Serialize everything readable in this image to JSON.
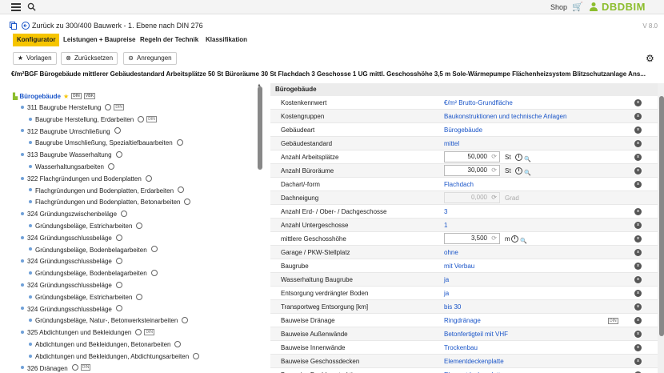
{
  "topbar": {
    "shop_label": "Shop",
    "logo": "DBDBIM",
    "menu_icon": "menu-icon",
    "search_icon": "search-icon",
    "cart_icon": "cart-icon",
    "user_icon": "user-icon"
  },
  "nav": {
    "back_label": "Zurück zu 300/400 Bauwerk - 1. Ebene nach DIN 276",
    "version": "V 8.0"
  },
  "tabs": [
    {
      "label": "Konfigurator",
      "active": true
    },
    {
      "label": "Leistungen + Baupreise",
      "active": false
    },
    {
      "label": "Regeln der Technik",
      "active": false
    },
    {
      "label": "Klassifikation",
      "active": false
    }
  ],
  "actions": {
    "vorlagen": "Vorlagen",
    "zuruecksetzen": "Zurücksetzen",
    "anregungen": "Anregungen"
  },
  "summary": "€/m²BGF Bürogebäude mittlerer Gebäudestandard Arbeitsplätze 50 St Büroräume 30 St Flachdach 3 Geschosse 1 UG mittl. Geschosshöhe 3,5 m Sole-Wärmepumpe Flächenheizsystem Blitzschutzanlage Ans...",
  "tree": {
    "root": "Bürogebäude",
    "din_label": "DIN",
    "vbk_label": "VBK",
    "items": [
      {
        "label": "311 Baugrube Herstellung",
        "level": 1,
        "din": true
      },
      {
        "label": "Baugrube Herstellung, Erdarbeiten",
        "level": 2,
        "din": true
      },
      {
        "label": "312 Baugrube Umschließung",
        "level": 1,
        "din": false
      },
      {
        "label": "Baugrube Umschließung, Spezialtiefbauarbeiten",
        "level": 2,
        "din": false
      },
      {
        "label": "313 Baugrube Wasserhaltung",
        "level": 1,
        "din": false
      },
      {
        "label": "Wasserhaltungsarbeiten",
        "level": 2,
        "din": false
      },
      {
        "label": "322 Flachgründungen und Bodenplatten",
        "level": 1,
        "din": false
      },
      {
        "label": "Flachgründungen und Bodenplatten, Erdarbeiten",
        "level": 2,
        "din": false
      },
      {
        "label": "Flachgründungen und Bodenplatten, Betonarbeiten",
        "level": 2,
        "din": false
      },
      {
        "label": "324 Gründungszwischenbeläge",
        "level": 1,
        "din": false
      },
      {
        "label": "Gründungsbeläge, Estricharbeiten",
        "level": 2,
        "din": false
      },
      {
        "label": "324 Gründungsschlussbeläge",
        "level": 1,
        "din": false
      },
      {
        "label": "Gründungsbeläge, Bodenbelagarbeiten",
        "level": 2,
        "din": false
      },
      {
        "label": "324 Gründungsschlussbeläge",
        "level": 1,
        "din": false
      },
      {
        "label": "Gründungsbeläge, Bodenbelagarbeiten",
        "level": 2,
        "din": false
      },
      {
        "label": "324 Gründungsschlussbeläge",
        "level": 1,
        "din": false
      },
      {
        "label": "Gründungsbeläge, Estricharbeiten",
        "level": 2,
        "din": false
      },
      {
        "label": "324 Gründungsschlussbeläge",
        "level": 1,
        "din": false
      },
      {
        "label": "Gründungsbeläge, Natur-, Betonwerksteinarbeiten",
        "level": 2,
        "din": false
      },
      {
        "label": "325 Abdichtungen und Bekleidungen",
        "level": 1,
        "din": true
      },
      {
        "label": "Abdichtungen und Bekleidungen, Betonarbeiten",
        "level": 2,
        "din": false
      },
      {
        "label": "Abdichtungen und Bekleidungen, Abdichtungsarbeiten",
        "level": 2,
        "din": false
      },
      {
        "label": "326 Dränagen",
        "level": 1,
        "din": true
      }
    ]
  },
  "panel": {
    "title": "Bürogebäude",
    "rows": [
      {
        "label": "Kostenkennwert",
        "value": "€/m² Brutto-Grundfläche",
        "type": "text"
      },
      {
        "label": "Kostengruppen",
        "value": "Baukonstruktionen und technische Anlagen",
        "type": "text"
      },
      {
        "label": "Gebäudeart",
        "value": "Bürogebäude",
        "type": "text"
      },
      {
        "label": "Gebäudestandard",
        "value": "mittel",
        "type": "text"
      },
      {
        "label": "Anzahl Arbeitsplätze",
        "value": "50,000",
        "unit": "St",
        "type": "input"
      },
      {
        "label": "Anzahl Büroräume",
        "value": "30,000",
        "unit": "St",
        "type": "input"
      },
      {
        "label": "Dachart/-form",
        "value": "Flachdach",
        "type": "text"
      },
      {
        "label": "Dachneigung",
        "value": "0,000",
        "unit": "Grad",
        "type": "disabled"
      },
      {
        "label": "Anzahl Erd- / Ober- / Dachgeschosse",
        "value": "3",
        "type": "text"
      },
      {
        "label": "Anzahl Untergeschosse",
        "value": "1",
        "type": "text"
      },
      {
        "label": "mittlere Geschosshöhe",
        "value": "3,500",
        "unit": "m",
        "type": "input"
      },
      {
        "label": "Garage / PKW-Stellplatz",
        "value": "ohne",
        "type": "text"
      },
      {
        "label": "Baugrube",
        "value": "mit Verbau",
        "type": "text"
      },
      {
        "label": "Wasserhaltung Baugrube",
        "value": "ja",
        "type": "text"
      },
      {
        "label": "Entsorgung verdrängter Boden",
        "value": "ja",
        "type": "text"
      },
      {
        "label": "Transportweg Entsorgung [km]",
        "value": "bis 30",
        "type": "text"
      },
      {
        "label": "Bauweise Dränage",
        "value": "Ringdränage",
        "type": "text",
        "din": true
      },
      {
        "label": "Bauweise Außenwände",
        "value": "Betonfertigteil mit VHF",
        "type": "text"
      },
      {
        "label": "Bauweise Innenwände",
        "value": "Trockenbau",
        "type": "text"
      },
      {
        "label": "Bauweise Geschossdecken",
        "value": "Elementdeckenplatte",
        "type": "text"
      },
      {
        "label": "Bauweise Dachkonstruktionen",
        "value": "Elementdeckenplatte",
        "type": "text"
      }
    ]
  }
}
